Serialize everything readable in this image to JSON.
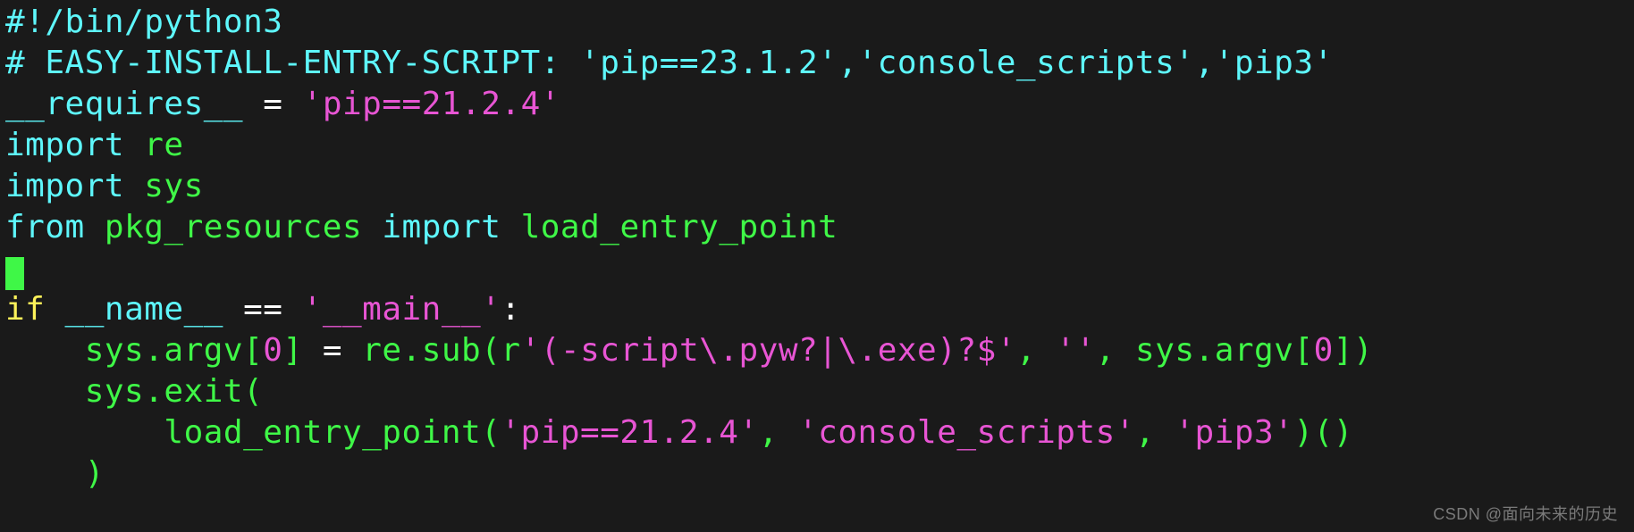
{
  "code": {
    "shebang": "#!/bin/python3",
    "easy_comment": "# EASY-INSTALL-ENTRY-SCRIPT: ",
    "easy_s1": "'pip==23.1.2'",
    "easy_c1": ",",
    "easy_s2": "'console_scripts'",
    "easy_c2": ",",
    "easy_s3": "'pip3'",
    "requires_name": "__requires__",
    "requires_eq_pad_left": " ",
    "equals_sign": "=",
    "requires_eq_pad_right": " ",
    "requires_val": "'pip==21.2.4'",
    "kw_import1": "import",
    "sp": " ",
    "mod_re": "re",
    "kw_import2": "import",
    "mod_sys": "sys",
    "kw_from": "from",
    "mod_pkg": "pkg_resources",
    "kw_import3": "import",
    "fn_load": "load_entry_point",
    "kw_if": "if",
    "dunder_name": "__name__",
    "cmp_eq": " == ",
    "str_main": "'__main__'",
    "colon": ":",
    "indent1": "    ",
    "indent2": "        ",
    "sys_argv0_lhs": "sys.argv[",
    "zero": "0",
    "close_bracket": "]",
    "assign_sp": " = ",
    "re_sub_call": "re.sub(r",
    "argv_regex": "'(-script\\.pyw?|\\.exe)?$'",
    "comma_sp": ", ",
    "empty_str": "''",
    "sys_argv_rhs_a": "sys.argv[",
    "sys_argv_rhs_b": "])",
    "sys_exit": "sys.exit(",
    "lep_call_a": "load_entry_point(",
    "lep_s1": "'pip==21.2.4'",
    "lep_s2": "'console_scripts'",
    "lep_s3": "'pip3'",
    "lep_close": ")()",
    "close_paren": ")"
  },
  "watermark": "CSDN @面向未来的历史"
}
